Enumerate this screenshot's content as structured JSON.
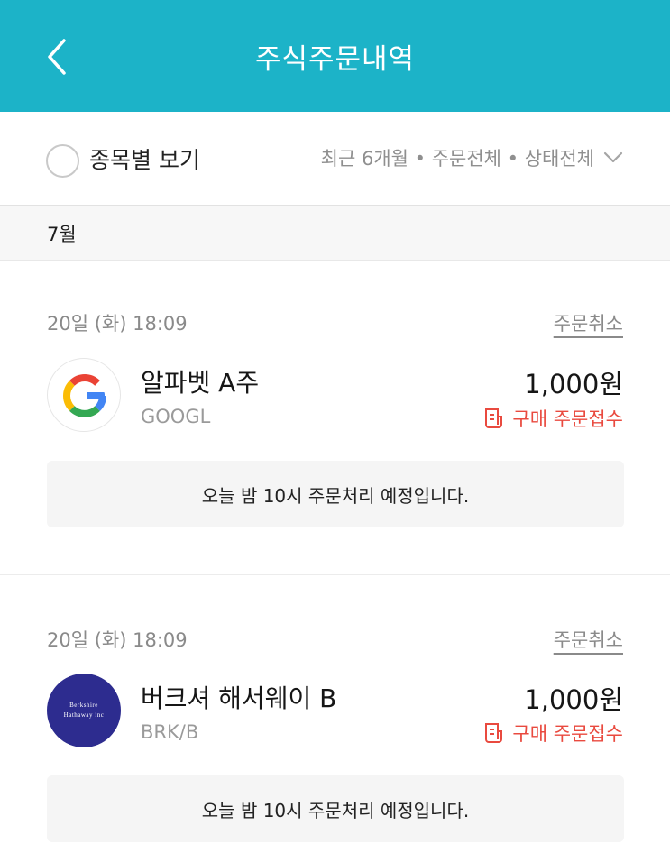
{
  "header": {
    "title": "주식주문내역"
  },
  "filter": {
    "group_by_label": "종목별 보기",
    "summary": "최근 6개월 • 주문전체 • 상태전체"
  },
  "month": "7월",
  "orders": [
    {
      "datetime": "20일 (화) 18:09",
      "cancel_label": "주문취소",
      "name": "알파벳 A주",
      "ticker": "GOOGL",
      "amount": "1,000원",
      "status": "구매 주문접수",
      "notice": "오늘 밤 10시 주문처리 예정입니다.",
      "logo": "google-logo"
    },
    {
      "datetime": "20일 (화) 18:09",
      "cancel_label": "주문취소",
      "name": "버크셔 해서웨이 B",
      "ticker": "BRK/B",
      "amount": "1,000원",
      "status": "구매 주문접수",
      "notice": "오늘 밤 10시 주문처리 예정입니다.",
      "logo": "berkshire-hathaway-logo",
      "logo_text_line1": "Berkshire",
      "logo_text_line2": "Hathaway inc"
    }
  ],
  "colors": {
    "header_bg": "#1cb3c8",
    "status_red": "#e94a3f",
    "brk_logo_bg": "#2d2c8f"
  }
}
